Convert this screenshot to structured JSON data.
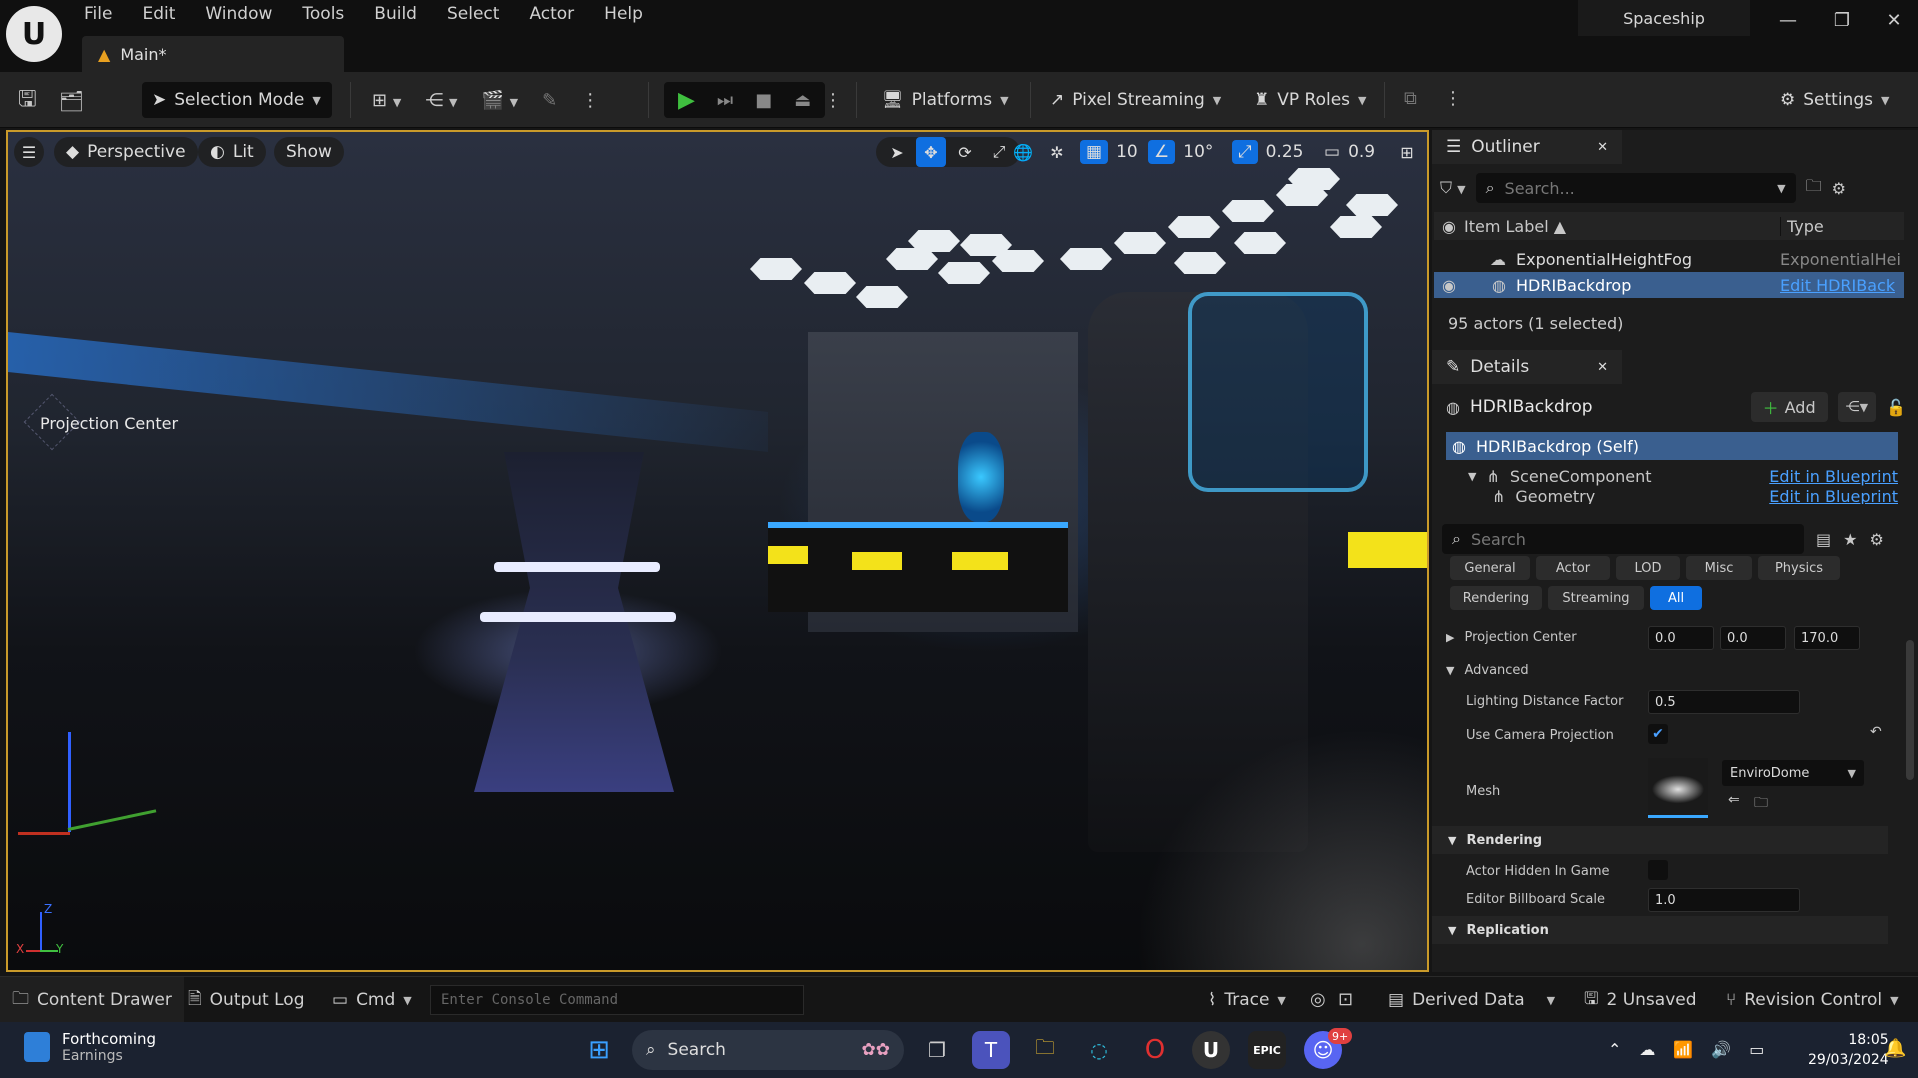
{
  "menu": [
    "File",
    "Edit",
    "Window",
    "Tools",
    "Build",
    "Select",
    "Actor",
    "Help"
  ],
  "tab": {
    "label": "Main*"
  },
  "project": {
    "name": "Spaceship"
  },
  "window_controls": {
    "minimize": "—",
    "maximize": "❐",
    "close": "✕"
  },
  "toolbar": {
    "selection_mode": "Selection Mode",
    "platforms": "Platforms",
    "pixel_streaming": "Pixel Streaming",
    "vp_roles": "VP Roles",
    "settings": "Settings"
  },
  "viewport": {
    "perspective": "Perspective",
    "lit": "Lit",
    "show": "Show",
    "grid_snap": "10",
    "rotation_snap": "10°",
    "scale_snap": "0.25",
    "camera_speed": "0.9",
    "projection_label": "Projection Center",
    "axis_z": "Z",
    "axis_y": "Y",
    "axis_x": "X"
  },
  "outliner": {
    "title": "Outliner",
    "search_placeholder": "Search...",
    "col_label": "Item Label",
    "col_type": "Type",
    "rows": [
      {
        "label": "ExponentialHeightFog",
        "type": "ExponentialHei"
      },
      {
        "label": "HDRIBackdrop",
        "type": "Edit HDRIBack"
      }
    ],
    "footer": "95 actors (1 selected)"
  },
  "details": {
    "title": "Details",
    "actor_name": "HDRIBackdrop",
    "add_label": "Add",
    "components": [
      {
        "label": "HDRIBackdrop (Self)",
        "link": ""
      },
      {
        "label": "SceneComponent",
        "link": "Edit in Blueprint"
      },
      {
        "label": "Geometry",
        "link": "Edit in Blueprint"
      }
    ],
    "search_placeholder": "Search",
    "categories_row1": [
      "General",
      "Actor",
      "LOD",
      "Misc",
      "Physics"
    ],
    "categories_row2": [
      "Rendering",
      "Streaming",
      "All"
    ],
    "projection_center": {
      "label": "Projection Center",
      "x": "0.0",
      "y": "0.0",
      "z": "170.0"
    },
    "advanced_header": "Advanced",
    "lighting_distance": {
      "label": "Lighting Distance Factor",
      "value": "0.5"
    },
    "use_camera_projection": {
      "label": "Use Camera Projection",
      "checked": true
    },
    "mesh": {
      "label": "Mesh",
      "value": "EnviroDome"
    },
    "rendering_header": "Rendering",
    "actor_hidden": {
      "label": "Actor Hidden In Game",
      "checked": false
    },
    "billboard_scale": {
      "label": "Editor Billboard Scale",
      "value": "1.0"
    },
    "replication_header": "Replication"
  },
  "statusbar": {
    "content_drawer": "Content Drawer",
    "output_log": "Output Log",
    "cmd": "Cmd",
    "console_placeholder": "Enter Console Command",
    "trace": "Trace",
    "derived_data": "Derived Data",
    "unsaved": "2 Unsaved",
    "revision_control": "Revision Control"
  },
  "taskbar": {
    "widget_title": "Forthcoming",
    "widget_subtitle": "Earnings",
    "search": "Search",
    "time": "18:05",
    "date": "29/03/2024",
    "badge": "9+"
  },
  "colors": {
    "accent": "#0f6fe0",
    "viewport_border": "#c99a2a",
    "play_green": "#3fbf3f",
    "link": "#4aa0ff"
  }
}
